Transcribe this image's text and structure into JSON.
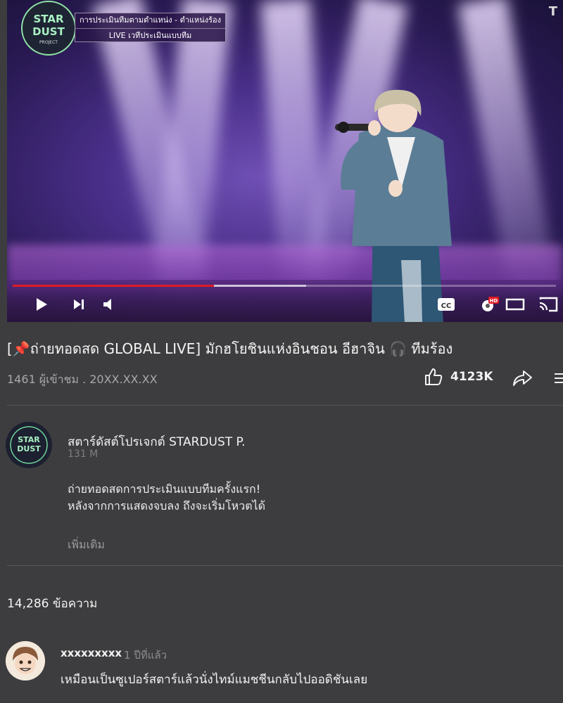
{
  "video": {
    "overlay_line1": "การประเมินทีมตามตำแหน่ง - ตำแหน่งร้อง",
    "overlay_line2": "LIVE เวทีประเมินแบบทีม",
    "corner_mark": "T",
    "progress_played": 0.37,
    "progress_buffered": 0.54,
    "logo_text_1": "STAR",
    "logo_text_2": "DUST",
    "logo_text_3": "PROJECT",
    "controls": [
      "play-icon",
      "skip-next-icon",
      "volume-icon",
      "captions-icon",
      "settings-hd-icon",
      "miniplayer-icon",
      "cast-icon"
    ],
    "cc_label": "CC",
    "hd_label": "HD"
  },
  "title": "[📌ถ่ายทอดสด GLOBAL LIVE] มักฮโยชินแห่งอินชอน อีฮาจิน 🎧 ทีมร้อง",
  "meta": {
    "views_date": "1461 ผู้เข้าชม . 20XX.XX.XX",
    "likes": "4123K"
  },
  "channel": {
    "name": "สตาร์ดัสต์โปรเจกต์ STARDUST P.",
    "subscribers": "131 M",
    "description_line1": "ถ่ายทอดสดการประเมินแบบทีมครั้งแรก!",
    "description_line2": "หลังจากการแสดงจบลง ถึงจะเริ่มโหวตได้",
    "more_label": "เพิ่มเติม"
  },
  "comments": {
    "count_label": "14,286 ข้อความ",
    "items": [
      {
        "user": "xxxxxxxxx",
        "time": "1 ปีที่แล้ว",
        "text": "เหมือนเป็นซูเปอร์สตาร์แล้วนั่งไทม์แมชชีนกลับไปออดิชันเลย"
      }
    ]
  },
  "colors": {
    "background": "#3d3d3f",
    "progress_played": "#e01b24",
    "settings_badge": "#e01b24"
  }
}
